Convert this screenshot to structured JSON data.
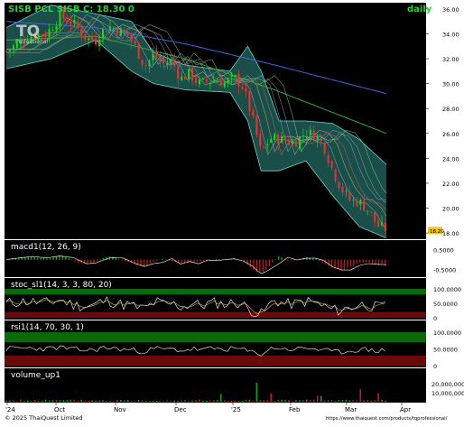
{
  "header": {
    "symbol_line": "SISB PCL SISB C: 18.30 0",
    "interval": "daily",
    "logo_main": "TQ",
    "logo_sub": "Professional"
  },
  "colors": {
    "background": "#000000",
    "panel_text": "#ffffff",
    "title": "#2ecc40",
    "up_candle": "#19d919",
    "down_candle": "#ff2b2b",
    "bb_fill": "#1e5c56",
    "bb_line": "#6fd3c6",
    "ma_long": "#4a63d8",
    "ma_mid": "#3aa53a",
    "ma_short": "#c9b07a",
    "overbought_band": "#0a6a0a",
    "oversold_band": "#6a0a0a"
  },
  "chart_data": [
    {
      "panel": "price",
      "type": "candlestick",
      "ylim": [
        17.5,
        36.5
      ],
      "y_ticks": [
        "36.00",
        "34.00",
        "32.00",
        "30.00",
        "28.00",
        "26.00",
        "24.00",
        "22.00",
        "20.00",
        "18.00"
      ],
      "last_price_tag": "18.20",
      "x_tick_labels": [
        "'24",
        "Oct",
        "Nov",
        "Dec",
        "'25",
        "Feb",
        "Mar",
        "Apr"
      ],
      "close_path": [
        {
          "d": 0,
          "c": 32.6
        },
        {
          "d": 6,
          "c": 33.3
        },
        {
          "d": 12,
          "c": 33.9
        },
        {
          "d": 18,
          "c": 34.0
        },
        {
          "d": 24,
          "c": 35.4
        },
        {
          "d": 30,
          "c": 34.8
        },
        {
          "d": 36,
          "c": 33.6
        },
        {
          "d": 40,
          "c": 33.5
        },
        {
          "d": 42,
          "c": 34.1
        },
        {
          "d": 46,
          "c": 34.6
        },
        {
          "d": 50,
          "c": 34.3
        },
        {
          "d": 54,
          "c": 34.0
        },
        {
          "d": 58,
          "c": 32.8
        },
        {
          "d": 62,
          "c": 31.4
        },
        {
          "d": 66,
          "c": 32.3
        },
        {
          "d": 70,
          "c": 31.6
        },
        {
          "d": 74,
          "c": 31.8
        },
        {
          "d": 78,
          "c": 30.4
        },
        {
          "d": 82,
          "c": 30.8
        },
        {
          "d": 86,
          "c": 30.0
        },
        {
          "d": 90,
          "c": 30.2
        },
        {
          "d": 94,
          "c": 30.3
        },
        {
          "d": 98,
          "c": 30.0
        },
        {
          "d": 102,
          "c": 30.5
        },
        {
          "d": 106,
          "c": 29.7
        },
        {
          "d": 110,
          "c": 27.3
        },
        {
          "d": 114,
          "c": 24.4
        },
        {
          "d": 118,
          "c": 25.6
        },
        {
          "d": 122,
          "c": 25.6
        },
        {
          "d": 126,
          "c": 25.3
        },
        {
          "d": 130,
          "c": 25.4
        },
        {
          "d": 134,
          "c": 26.1
        },
        {
          "d": 138,
          "c": 25.9
        },
        {
          "d": 142,
          "c": 25.0
        },
        {
          "d": 146,
          "c": 23.0
        },
        {
          "d": 150,
          "c": 21.5
        },
        {
          "d": 154,
          "c": 20.6
        },
        {
          "d": 158,
          "c": 20.5
        },
        {
          "d": 162,
          "c": 19.8
        },
        {
          "d": 166,
          "c": 18.6
        },
        {
          "d": 170,
          "c": 18.3
        }
      ],
      "ma_long": [
        [
          0,
          35.0
        ],
        [
          40,
          34.5
        ],
        [
          80,
          33.2
        ],
        [
          120,
          31.5
        ],
        [
          170,
          29.2
        ]
      ],
      "ma_mid": [
        [
          0,
          33.5
        ],
        [
          40,
          33.8
        ],
        [
          80,
          32.0
        ],
        [
          120,
          29.5
        ],
        [
          170,
          26.0
        ]
      ],
      "bb_upper": [
        [
          0,
          34.5
        ],
        [
          20,
          36.3
        ],
        [
          40,
          35.6
        ],
        [
          56,
          35.0
        ],
        [
          66,
          32.5
        ],
        [
          80,
          31.5
        ],
        [
          100,
          31.0
        ],
        [
          108,
          33.0
        ],
        [
          114,
          31.0
        ],
        [
          122,
          27.0
        ],
        [
          134,
          27.0
        ],
        [
          146,
          26.8
        ],
        [
          158,
          25.5
        ],
        [
          170,
          23.5
        ]
      ],
      "bb_lower": [
        [
          0,
          31.2
        ],
        [
          20,
          32.0
        ],
        [
          40,
          33.5
        ],
        [
          56,
          31.0
        ],
        [
          66,
          30.0
        ],
        [
          80,
          29.5
        ],
        [
          100,
          29.3
        ],
        [
          108,
          27.0
        ],
        [
          114,
          23.0
        ],
        [
          122,
          23.0
        ],
        [
          134,
          23.8
        ],
        [
          146,
          21.0
        ],
        [
          158,
          18.5
        ],
        [
          170,
          17.6
        ]
      ]
    },
    {
      "panel": "macd",
      "label": "macd1(12, 26, 9)",
      "ylim": [
        -0.8,
        0.8
      ],
      "y_ticks": [
        "0.5000",
        "-0.5000"
      ]
    },
    {
      "panel": "stochastic",
      "label": "stoc_sl1(14, 3, 3, 80, 20)",
      "ylim": [
        0,
        100
      ],
      "y_ticks": [
        "100.0000",
        "50.0000",
        "0"
      ],
      "overbought": 80,
      "oversold": 20
    },
    {
      "panel": "rsi",
      "label": "rsi1(14, 70, 30, 1)",
      "ylim": [
        0,
        100
      ],
      "y_ticks": [
        "100.0000",
        "50.0000",
        "0"
      ],
      "overbought": 70,
      "oversold": 30
    },
    {
      "panel": "volume",
      "label": "volume_up1",
      "ylim": [
        0,
        25000000
      ],
      "y_ticks": [
        "20,000,000",
        "10,000,000"
      ],
      "spikes": [
        [
          96,
          8500000
        ],
        [
          112,
          21000000
        ],
        [
          118,
          9000000
        ],
        [
          140,
          6500000
        ],
        [
          158,
          14000000
        ],
        [
          166,
          9500000
        ]
      ]
    }
  ],
  "footer": {
    "copyright": "© 2025 ThaiQuest Limited",
    "url": "https://www.thaiquest.com/products/tqprofessional/"
  }
}
